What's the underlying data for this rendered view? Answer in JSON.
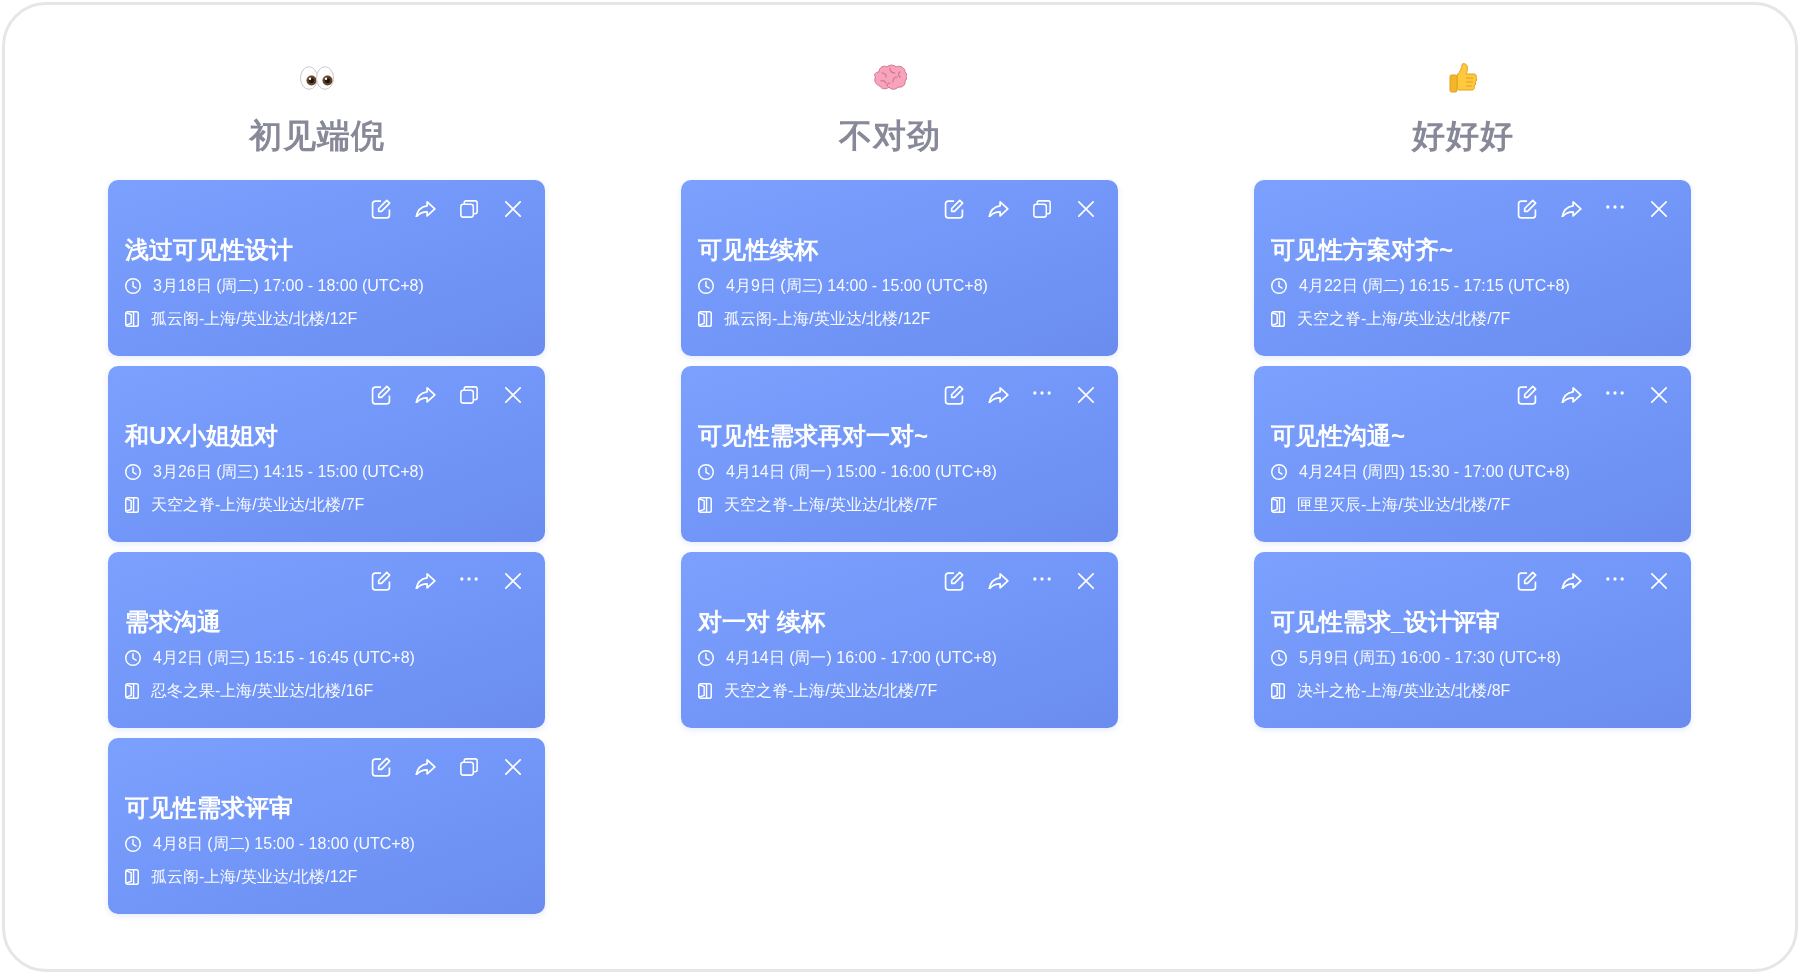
{
  "columns": [
    {
      "kind": "eyes",
      "title": "初见端倪",
      "cards": [
        {
          "title": "浅过可见性设计",
          "time": "3月18日 (周二) 17:00 - 18:00 (UTC+8)",
          "location": "孤云阁-上海/英业达/北楼/12F",
          "actions": [
            {
              "kind": "edit"
            },
            {
              "kind": "share"
            },
            {
              "kind": "copy"
            },
            {
              "kind": "close"
            }
          ]
        },
        {
          "title": "和UX小姐姐对",
          "time": "3月26日 (周三) 14:15 - 15:00 (UTC+8)",
          "location": "天空之脊-上海/英业达/北楼/7F",
          "actions": [
            {
              "kind": "edit"
            },
            {
              "kind": "share"
            },
            {
              "kind": "copy"
            },
            {
              "kind": "close"
            }
          ]
        },
        {
          "title": "需求沟通",
          "time": "4月2日 (周三) 15:15 - 16:45 (UTC+8)",
          "location": "忍冬之果-上海/英业达/北楼/16F",
          "actions": [
            {
              "kind": "edit"
            },
            {
              "kind": "share"
            },
            {
              "kind": "more"
            },
            {
              "kind": "close"
            }
          ]
        },
        {
          "title": "可见性需求评审",
          "time": "4月8日 (周二) 15:00 - 18:00 (UTC+8)",
          "location": "孤云阁-上海/英业达/北楼/12F",
          "actions": [
            {
              "kind": "edit"
            },
            {
              "kind": "share"
            },
            {
              "kind": "copy"
            },
            {
              "kind": "close"
            }
          ]
        }
      ]
    },
    {
      "kind": "brain",
      "title": "不对劲",
      "cards": [
        {
          "title": "可见性续杯",
          "time": "4月9日 (周三) 14:00 - 15:00 (UTC+8)",
          "location": "孤云阁-上海/英业达/北楼/12F",
          "actions": [
            {
              "kind": "edit"
            },
            {
              "kind": "share"
            },
            {
              "kind": "copy"
            },
            {
              "kind": "close"
            }
          ]
        },
        {
          "title": "可见性需求再对一对~",
          "time": "4月14日 (周一) 15:00 - 16:00 (UTC+8)",
          "location": "天空之脊-上海/英业达/北楼/7F",
          "actions": [
            {
              "kind": "edit"
            },
            {
              "kind": "share"
            },
            {
              "kind": "more"
            },
            {
              "kind": "close"
            }
          ]
        },
        {
          "title": "对一对 续杯",
          "time": "4月14日 (周一) 16:00 - 17:00 (UTC+8)",
          "location": "天空之脊-上海/英业达/北楼/7F",
          "actions": [
            {
              "kind": "edit"
            },
            {
              "kind": "share"
            },
            {
              "kind": "more"
            },
            {
              "kind": "close"
            }
          ]
        }
      ]
    },
    {
      "kind": "thumbs_up",
      "title": "好好好",
      "cards": [
        {
          "title": "可见性方案对齐~",
          "time": "4月22日 (周二) 16:15 - 17:15 (UTC+8)",
          "location": "天空之脊-上海/英业达/北楼/7F",
          "actions": [
            {
              "kind": "edit"
            },
            {
              "kind": "share"
            },
            {
              "kind": "more"
            },
            {
              "kind": "close"
            }
          ]
        },
        {
          "title": "可见性沟通~",
          "time": "4月24日 (周四) 15:30 - 17:00 (UTC+8)",
          "location": "匣里灭辰-上海/英业达/北楼/7F",
          "actions": [
            {
              "kind": "edit"
            },
            {
              "kind": "share"
            },
            {
              "kind": "more"
            },
            {
              "kind": "close"
            }
          ]
        },
        {
          "title": "可见性需求_设计评审",
          "time": "5月9日 (周五) 16:00 - 17:30 (UTC+8)",
          "location": "决斗之枪-上海/英业达/北楼/8F",
          "actions": [
            {
              "kind": "edit"
            },
            {
              "kind": "share"
            },
            {
              "kind": "more"
            },
            {
              "kind": "close"
            }
          ]
        }
      ]
    }
  ]
}
